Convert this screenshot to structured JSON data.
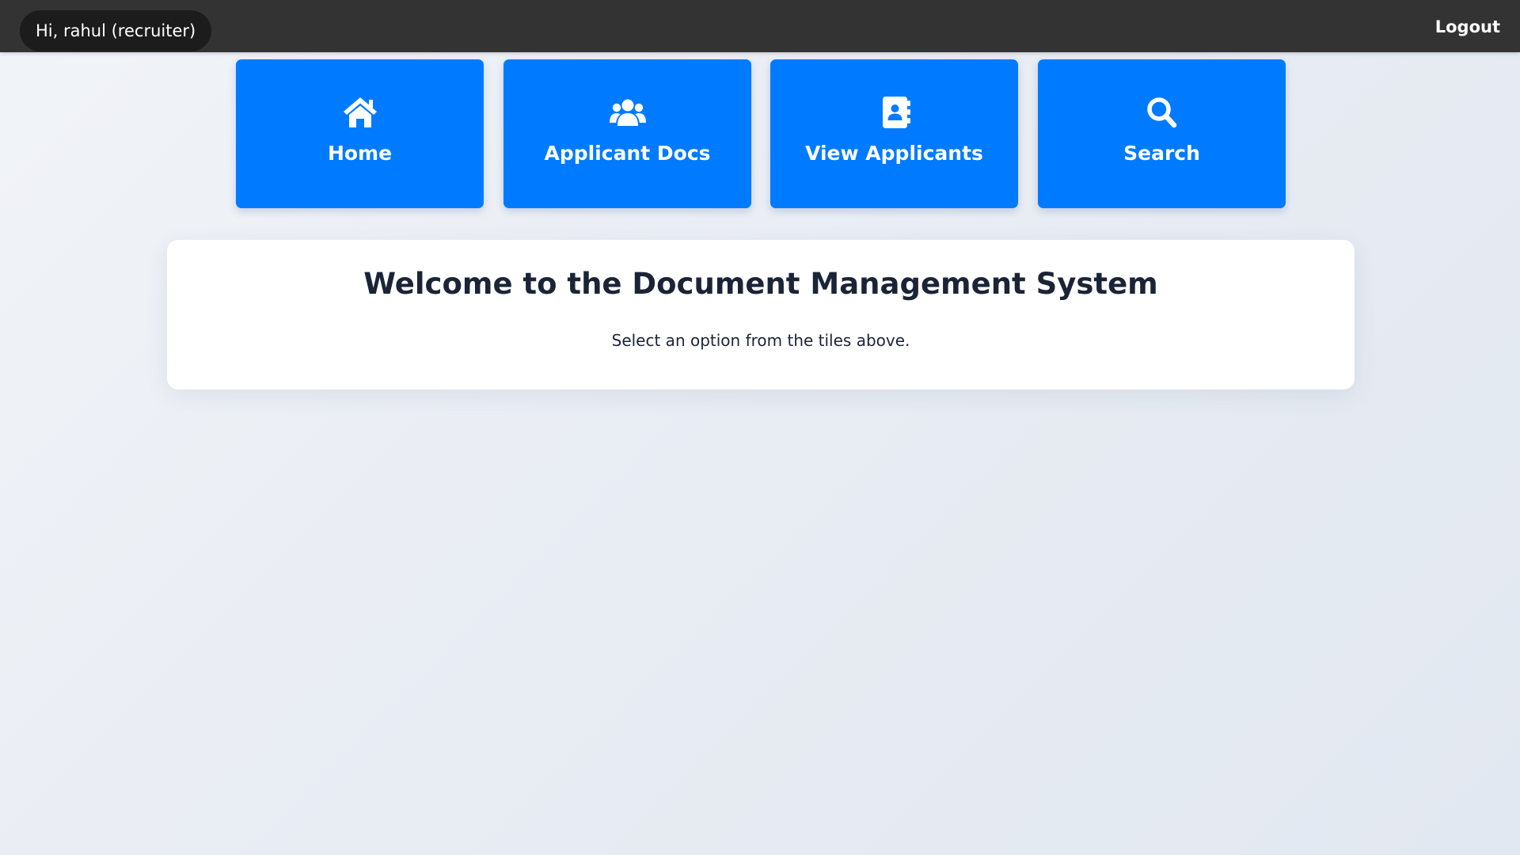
{
  "header": {
    "greeting": "Hi, rahul (recruiter)",
    "logout_label": "Logout"
  },
  "tiles": [
    {
      "label": "Home",
      "icon": "home-icon"
    },
    {
      "label": "Applicant Docs",
      "icon": "users-icon"
    },
    {
      "label": "View Applicants",
      "icon": "address-book-icon"
    },
    {
      "label": "Search",
      "icon": "search-icon"
    }
  ],
  "welcome": {
    "title": "Welcome to the Document Management System",
    "subtitle": "Select an option from the tiles above."
  },
  "colors": {
    "topbar": "#333333",
    "tile_blue": "#007bff",
    "text_dark": "#1b2437"
  }
}
